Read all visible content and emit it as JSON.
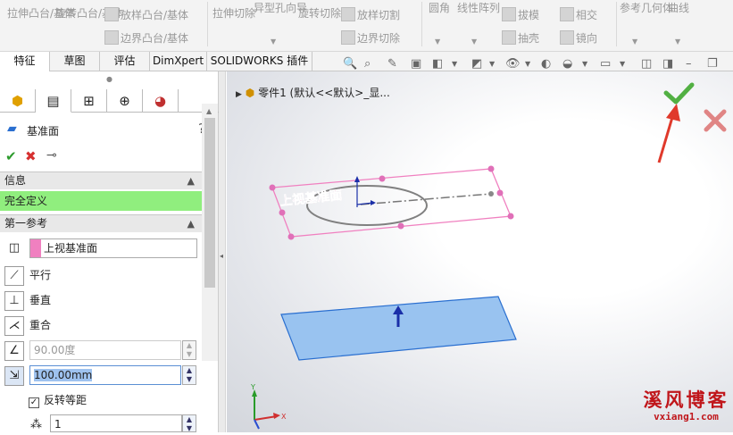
{
  "ribbon": {
    "extrude_boss": "拉伸凸台/基体",
    "revolve_boss": "旋转凸台/基体",
    "loft_boss": "放样凸台/基体",
    "boundary_boss": "边界凸台/基体",
    "extrude_cut": "拉伸切除",
    "hole_wizard": "异型孔向导",
    "revolve_cut": "旋转切除",
    "loft_cut": "放样切割",
    "boundary_cut": "边界切除",
    "fillet": "圆角",
    "linear_pattern": "线性阵列",
    "draft": "拔模",
    "shell": "抽壳",
    "intersect": "相交",
    "mirror": "镜向",
    "ref_geometry": "参考几何体",
    "curves": "曲线"
  },
  "tabs": [
    "特征",
    "草图",
    "评估",
    "DimXpert",
    "SOLIDWORKS 插件"
  ],
  "panel": {
    "title": "基准面",
    "help": "?",
    "info_section": "信息",
    "status": "完全定义",
    "first_ref_section": "第一参考",
    "ref_value": "上视基准面",
    "parallel": "平行",
    "perpendicular": "垂直",
    "coincident": "重合",
    "angle_value": "90.00度",
    "distance_value": "100.00mm",
    "flip_offset": "反转等距",
    "count_value": "1"
  },
  "tree": {
    "part": "零件1 (默认<<默认>_显..."
  },
  "viewport": {
    "plane_label": "上视基准面",
    "axis_x": "X",
    "axis_y": "Y"
  },
  "watermark": {
    "line1": "溪风博客",
    "line2": "vxiang1.com"
  },
  "colors": {
    "status_green": "#90ee7e",
    "accept": "#52b043",
    "cancel": "#e08585",
    "arrow": "#e0392b",
    "plane_fill": "#99c3f0",
    "plane_edge": "#2a6fd0",
    "pink": "#f080c0"
  }
}
